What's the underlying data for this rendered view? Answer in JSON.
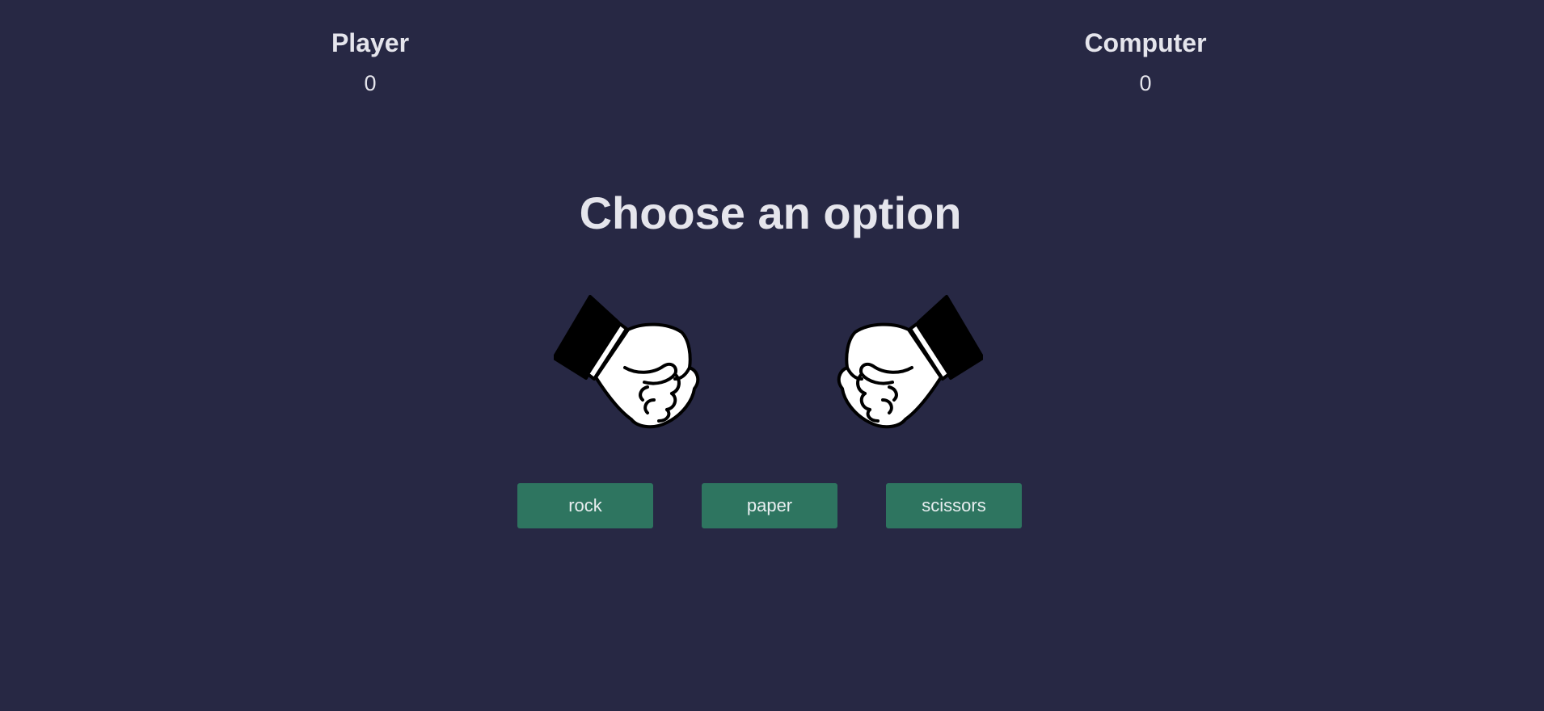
{
  "scoreboard": {
    "player": {
      "label": "Player",
      "score": "0"
    },
    "computer": {
      "label": "Computer",
      "score": "0"
    }
  },
  "prompt": "Choose an option",
  "hands": {
    "player": {
      "icon": "rock-fist-icon"
    },
    "computer": {
      "icon": "rock-fist-icon"
    }
  },
  "choices": [
    {
      "label": "rock"
    },
    {
      "label": "paper"
    },
    {
      "label": "scissors"
    }
  ],
  "colors": {
    "background": "#272844",
    "button": "#2e7560",
    "text": "#e5e5ec"
  }
}
